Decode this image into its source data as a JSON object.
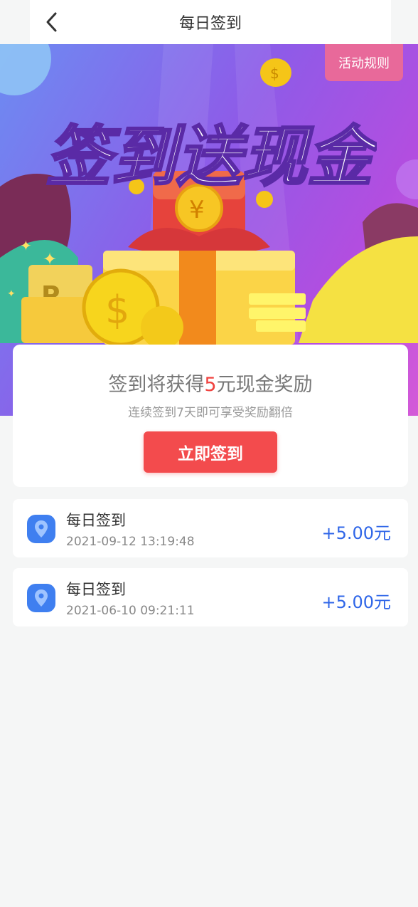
{
  "header": {
    "title": "每日签到",
    "back_icon": "chevron-left-icon"
  },
  "banner": {
    "rules_label": "活动规则",
    "headline": "签到送现金",
    "colors": {
      "bg_start": "#6c8cf2",
      "bg_end": "#d45ad8",
      "accent": "#f34b4d"
    }
  },
  "reward_card": {
    "text_prefix": "签到将获得",
    "amount": "5",
    "text_suffix": "元现金奖励",
    "subtext": "连续签到7天即可享受奖励翻倍",
    "button_label": "立即签到"
  },
  "records": [
    {
      "name": "每日签到",
      "time": "2021-09-12 13:19:48",
      "value": "+5.00元",
      "icon": "location-pin-icon"
    },
    {
      "name": "每日签到",
      "time": "2021-06-10 09:21:11",
      "value": "+5.00元",
      "icon": "location-pin-icon"
    }
  ]
}
